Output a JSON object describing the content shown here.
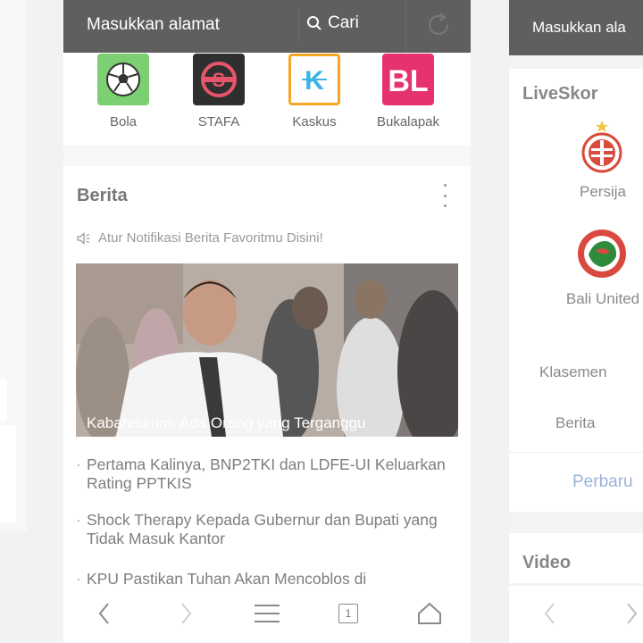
{
  "center": {
    "address_placeholder": "Masukkan alamat",
    "search_label": "Cari",
    "shortcuts": [
      {
        "label": "Bola",
        "icon": "soccer-ball-icon",
        "color": "#7ccf73"
      },
      {
        "label": "STAFA",
        "icon": "stafa-logo-icon",
        "color": "#2f2f2f"
      },
      {
        "label": "Kaskus",
        "icon": "kaskus-logo-icon",
        "color": "#f5a623"
      },
      {
        "label": "Bukalapak",
        "icon": "bukalapak-logo-icon",
        "color": "#e6336f"
      }
    ],
    "news": {
      "title": "Berita",
      "notif_text": "Atur Notifikasi Berita Favoritmu Disini!",
      "hero_caption": "Kabareskrim: Ada Orang yang Terganggu",
      "headlines": [
        "Pertama Kalinya, BNP2TKI dan LDFE-UI Keluarkan Rating PPTKIS",
        "Shock Therapy Kepada Gubernur dan Bupati yang Tidak Masuk Kantor",
        "KPU Pastikan Tuhan Akan Mencoblos di"
      ]
    },
    "tab_count": "1"
  },
  "right": {
    "address_placeholder": "Masukkan ala",
    "live_title": "LiveSkor",
    "teams": [
      "Persija",
      "Bali United"
    ],
    "links": [
      "Klasemen",
      "Berita"
    ],
    "more_label": "Perbaru",
    "video_title": "Video"
  }
}
